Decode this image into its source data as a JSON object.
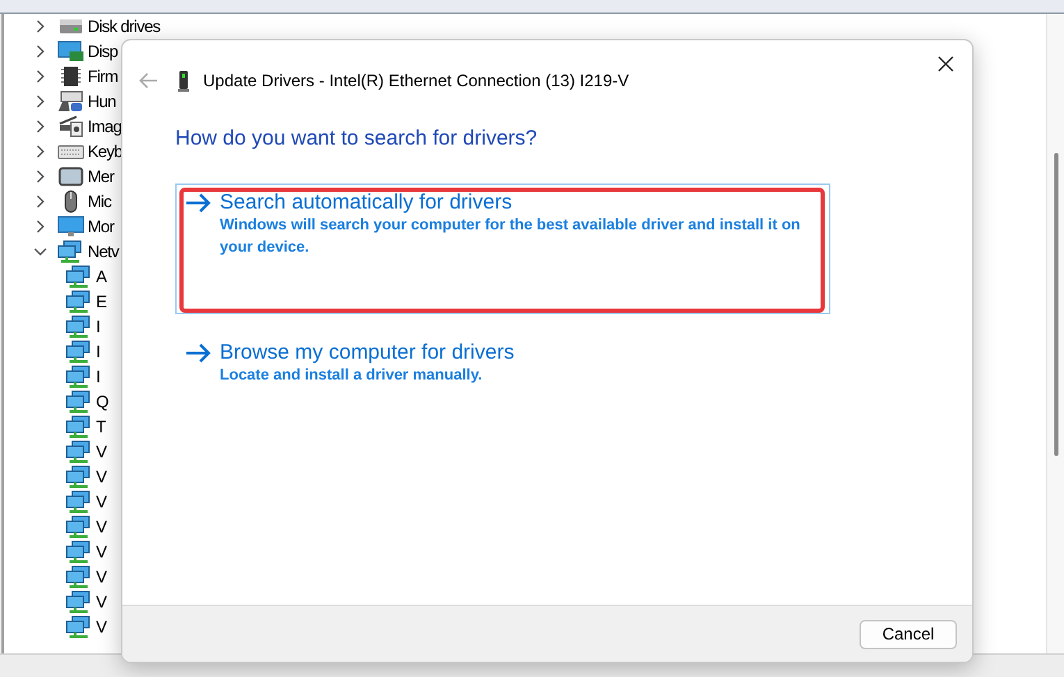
{
  "tree": {
    "items": [
      {
        "label": "Disk drives",
        "kind": "disk",
        "expanded": false
      },
      {
        "label": "Disp",
        "kind": "display",
        "expanded": false
      },
      {
        "label": "Firm",
        "kind": "chip",
        "expanded": false
      },
      {
        "label": "Hun",
        "kind": "hid",
        "expanded": false
      },
      {
        "label": "Imag",
        "kind": "camera",
        "expanded": false
      },
      {
        "label": "Keyb",
        "kind": "keyboard",
        "expanded": false
      },
      {
        "label": "Mer",
        "kind": "memory",
        "expanded": false
      },
      {
        "label": "Mic",
        "kind": "mouse",
        "expanded": false
      },
      {
        "label": "Mor",
        "kind": "monitor",
        "expanded": false
      },
      {
        "label": "Netv",
        "kind": "network",
        "expanded": true,
        "children": [
          {
            "label": "A",
            "kind": "network"
          },
          {
            "label": "E",
            "kind": "network"
          },
          {
            "label": "I",
            "kind": "network"
          },
          {
            "label": "I",
            "kind": "network"
          },
          {
            "label": "I",
            "kind": "network"
          },
          {
            "label": "Q",
            "kind": "network"
          },
          {
            "label": "T",
            "kind": "network"
          },
          {
            "label": "V",
            "kind": "network"
          },
          {
            "label": "V",
            "kind": "network"
          },
          {
            "label": "V",
            "kind": "network"
          },
          {
            "label": "V",
            "kind": "network"
          },
          {
            "label": "V",
            "kind": "network"
          },
          {
            "label": "V",
            "kind": "network"
          },
          {
            "label": "V",
            "kind": "network"
          },
          {
            "label": "V",
            "kind": "network"
          }
        ]
      }
    ]
  },
  "dialog": {
    "title": "Update Drivers - Intel(R) Ethernet Connection (13) I219-V",
    "heading": "How do you want to search for drivers?",
    "options": [
      {
        "title": "Search automatically for drivers",
        "description": "Windows will search your computer for the best available driver and install it on your device.",
        "selected": true,
        "highlighted": true
      },
      {
        "title": "Browse my computer for drivers",
        "description": "Locate and install a driver manually.",
        "selected": false,
        "highlighted": false
      }
    ],
    "buttons": [
      "Cancel"
    ]
  }
}
